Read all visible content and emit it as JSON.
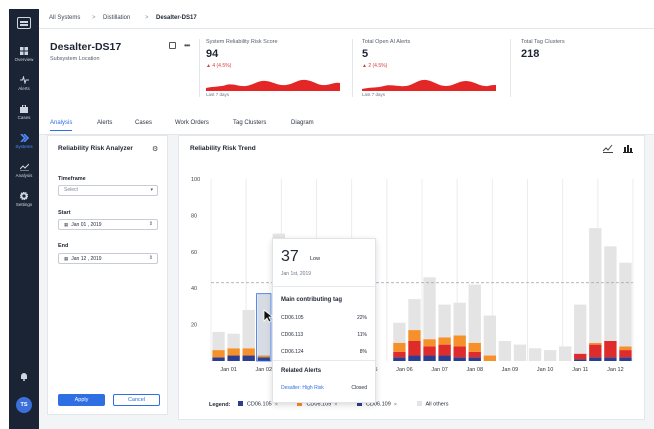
{
  "nav": {
    "items": [
      {
        "label": "Overview",
        "icon": "grid-icon"
      },
      {
        "label": "Alerts",
        "icon": "pulse-icon"
      },
      {
        "label": "Cases",
        "icon": "briefcase-icon"
      },
      {
        "label": "Systems",
        "icon": "chevron-right-icon"
      },
      {
        "label": "Analysis",
        "icon": "analysis-icon"
      },
      {
        "label": "Settings",
        "icon": "gear-icon"
      }
    ],
    "active": "Systems",
    "avatar": "TS"
  },
  "breadcrumb": {
    "items": [
      "All Systems",
      "Distillation",
      "Desalter-DS17"
    ],
    "separator": ">"
  },
  "asset": {
    "title": "Desalter-DS17",
    "subtitle": "Subsystem Location",
    "more": "•••"
  },
  "metrics": [
    {
      "label": "System Reliability Risk Score",
      "value": "94",
      "delta": "▲ 4 (4.5%)",
      "period": "Last 7 days"
    },
    {
      "label": "Total Open AI Alerts",
      "value": "5",
      "delta": "▲ 2 (4.5%)",
      "period": "Last 7 days"
    },
    {
      "label": "Total Tag Clusters",
      "value": "218"
    }
  ],
  "tabs": [
    "Analysis",
    "Alerts",
    "Cases",
    "Work Orders",
    "Tag Clusters",
    "Diagram"
  ],
  "active_tab": "Analysis",
  "analyzer": {
    "title": "Reliability Risk Analyzer",
    "timeframe_label": "Timeframe",
    "timeframe_placeholder": "Select",
    "start_label": "Start",
    "start_value": "Jan 01 , 2019",
    "end_label": "End",
    "end_value": "Jan 12 , 2019",
    "apply": "Apply",
    "cancel": "Cancel"
  },
  "tooltip": {
    "value": "37",
    "risk": "Low",
    "date": "Jan 1st, 2019",
    "contrib_title": "Main contributing tag",
    "contrib": [
      {
        "tag": "CD06.105",
        "pct": "22%"
      },
      {
        "tag": "CD06.113",
        "pct": "11%"
      },
      {
        "tag": "CD06.124",
        "pct": "8%"
      }
    ],
    "alerts_title": "Related Alerts",
    "alert_link": "Desalter: High Risk",
    "alert_status": "Closed"
  },
  "colors": {
    "accent": "#2f6fe4",
    "red": "#e02b2b",
    "orange": "#f5902b",
    "navy": "#2c3e8f",
    "gray": "#e4e4e4",
    "nav_bg": "#1b2434"
  },
  "chart_data": {
    "type": "bar",
    "title": "Reliability Risk Trend",
    "ylim": [
      0,
      100
    ],
    "yticks": [
      20,
      40,
      60,
      80,
      100
    ],
    "threshold": 43,
    "xlabels": [
      "Jan 01",
      "Jan 02",
      "Jan 03",
      "Jan 04",
      "Jan 05",
      "Jan 06",
      "Jan 07",
      "Jan 08",
      "Jan 09",
      "Jan 10",
      "Jan 11",
      "Jan 12"
    ],
    "categories": [
      "t1",
      "t2",
      "t3",
      "t4",
      "t5",
      "t6",
      "t7",
      "t8",
      "t9",
      "t10",
      "t11",
      "t12",
      "t13",
      "t14",
      "t15",
      "t16",
      "t17",
      "t18",
      "t19",
      "t20",
      "t21",
      "t22",
      "t23",
      "t24",
      "t25",
      "t26",
      "t27",
      "t28"
    ],
    "series": [
      {
        "name": "CD06.105",
        "color": "#2c3e8f",
        "values": [
          2,
          3,
          3,
          2,
          2,
          0,
          0,
          0,
          0,
          0,
          0,
          0,
          2,
          3,
          3,
          3,
          2,
          2,
          0,
          0,
          0,
          0,
          0,
          0,
          1,
          2,
          2,
          2
        ]
      },
      {
        "name": "CD06.113",
        "color": "#e02b2b",
        "values": [
          0,
          0,
          0,
          0,
          0,
          0,
          0,
          0,
          0,
          0,
          0,
          0,
          3,
          8,
          5,
          6,
          6,
          3,
          0,
          0,
          0,
          0,
          0,
          0,
          3,
          7,
          9,
          4
        ]
      },
      {
        "name": "CD06.109",
        "color": "#f5902b",
        "values": [
          4,
          4,
          4,
          1,
          2,
          0,
          0,
          0,
          0,
          0,
          0,
          0,
          5,
          6,
          4,
          4,
          6,
          5,
          3,
          0,
          0,
          0,
          0,
          0,
          0,
          1,
          0,
          2
        ]
      },
      {
        "name": "All others",
        "color": "#e4e4e4",
        "values": [
          10,
          8,
          21,
          34,
          66,
          0,
          0,
          0,
          0,
          0,
          0,
          0,
          11,
          17,
          34,
          18,
          18,
          32,
          22,
          11,
          9,
          7,
          6,
          8,
          27,
          63,
          52,
          46
        ]
      }
    ],
    "legend_title": "Legend:",
    "legend": [
      {
        "name": "CD06.105",
        "color": "#2c3e8f"
      },
      {
        "name": "CD06.109",
        "color": "#f5902b"
      },
      {
        "name": "CD06.109",
        "color": "#2c3e8f"
      },
      {
        "name": "All others",
        "color": "#e4e4e4"
      }
    ],
    "legend_remove": "×"
  }
}
